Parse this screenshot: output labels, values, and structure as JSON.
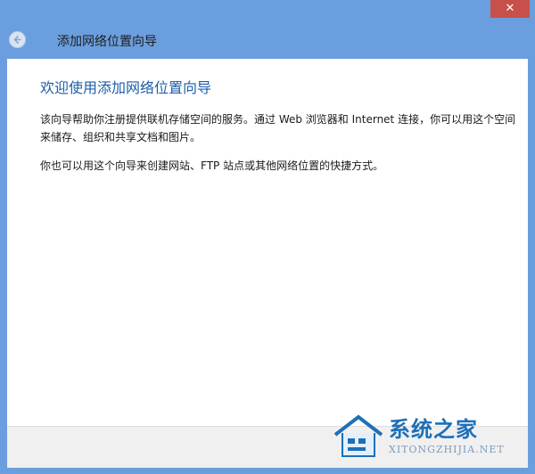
{
  "window": {
    "close_label": "✕",
    "title": "添加网络位置向导"
  },
  "main": {
    "heading": "欢迎使用添加网络位置向导",
    "paragraph1": "该向导帮助你注册提供联机存储空间的服务。通过 Web 浏览器和 Internet 连接，你可以用这个空间来储存、组织和共享文档和图片。",
    "paragraph2": "你也可以用这个向导来创建网站、FTP 站点或其他网络位置的快捷方式。"
  },
  "watermark": {
    "brand": "系统之家",
    "url": "XITONGZHIJIA.NET"
  },
  "colors": {
    "frame": "#6b9ede",
    "heading": "#1d5ea8",
    "close": "#c7504a"
  }
}
